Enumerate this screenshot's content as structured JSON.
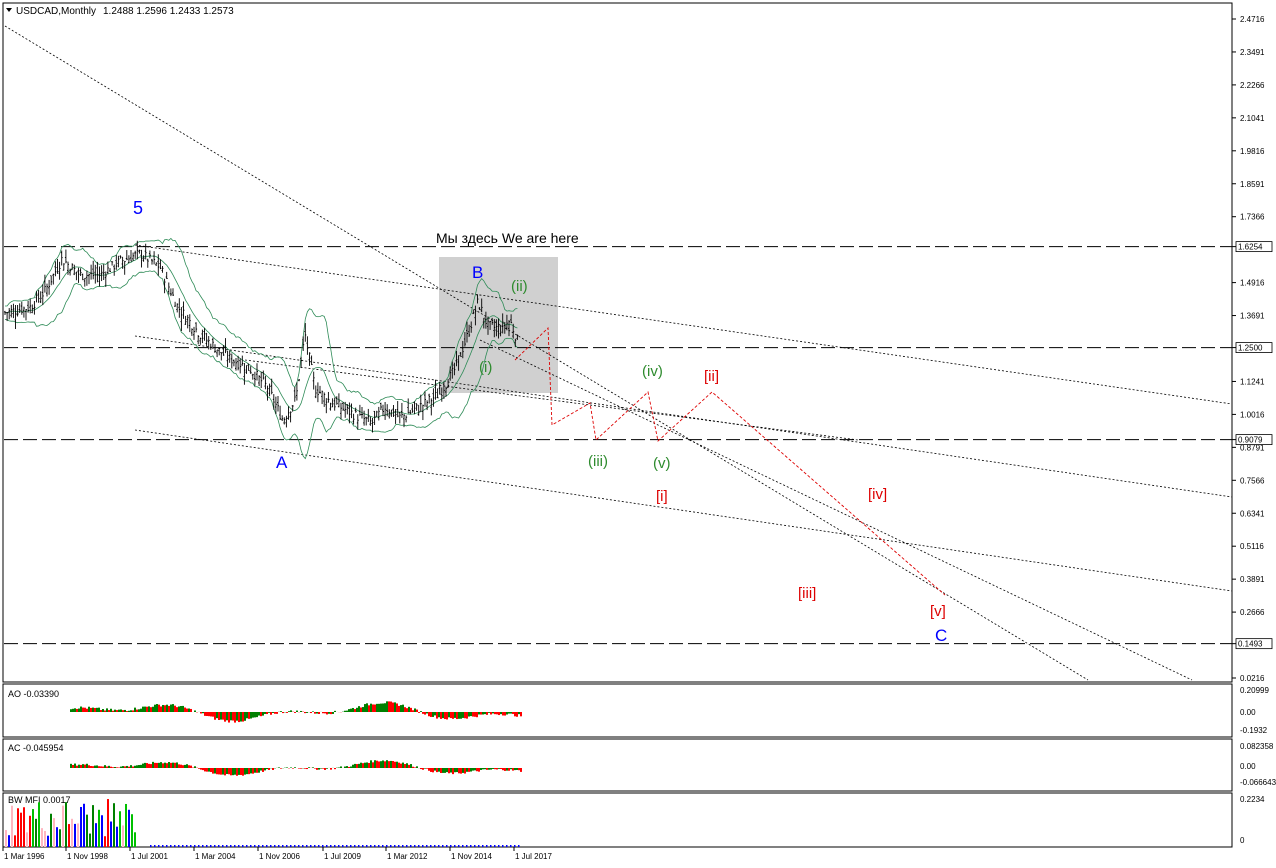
{
  "header": {
    "symbol_label": "USDCAD,Monthly",
    "ohlc": "1.2488 1.2596 1.2433 1.2573"
  },
  "annotation_here": "Мы здесь We are here",
  "price_axis": [
    "2.4716",
    "2.3491",
    "2.2266",
    "2.1041",
    "1.9816",
    "1.8591",
    "1.7366",
    "1.6254",
    "1.4916",
    "1.3691",
    "1.2500",
    "1.1241",
    "1.0016",
    "0.9079",
    "0.8791",
    "0.7566",
    "0.6341",
    "0.5116",
    "0.3891",
    "0.2666",
    "0.1493",
    "0.0216"
  ],
  "price_levels": [
    {
      "label": "1.6254",
      "value": 1.6254
    },
    {
      "label": "1.2500",
      "value": 1.25
    },
    {
      "label": "0.9079",
      "value": 0.9079
    },
    {
      "label": "0.1493",
      "value": 0.1493
    }
  ],
  "time_axis": [
    "1 Mar 1996",
    "1 Nov 1998",
    "1 Jul 2001",
    "1 Mar 2004",
    "1 Nov 2006",
    "1 Jul 2009",
    "1 Mar 2012",
    "1 Nov 2014",
    "1 Jul 2017"
  ],
  "wave_labels": [
    {
      "text": "5",
      "color": "#0000ff"
    },
    {
      "text": "A",
      "color": "#0000ff"
    },
    {
      "text": "B",
      "color": "#0000ff"
    },
    {
      "text": "C",
      "color": "#0000ff"
    },
    {
      "text": "(i)",
      "color": "#2e8b2e"
    },
    {
      "text": "(ii)",
      "color": "#2e8b2e"
    },
    {
      "text": "(iii)",
      "color": "#2e8b2e"
    },
    {
      "text": "(iv)",
      "color": "#2e8b2e"
    },
    {
      "text": "(v)",
      "color": "#2e8b2e"
    },
    {
      "text": "[i]",
      "color": "#dd0000"
    },
    {
      "text": "[ii]",
      "color": "#dd0000"
    },
    {
      "text": "[iii]",
      "color": "#dd0000"
    },
    {
      "text": "[iv]",
      "color": "#dd0000"
    },
    {
      "text": "[v]",
      "color": "#dd0000"
    }
  ],
  "ao": {
    "label": "AO -0.03390",
    "scale": [
      "0.20999",
      "0.00",
      "-0.1932"
    ]
  },
  "ac": {
    "label": "AC -0.045954",
    "scale": [
      "0.082358",
      "0.00",
      "-0.066643"
    ]
  },
  "bwmfi": {
    "label": "BW MFI 0.0017",
    "scale": [
      "0.2234",
      "0"
    ]
  },
  "colors": {
    "up": "#008000",
    "down": "#ff0000",
    "bands": "#2e8b57",
    "text": "#000000"
  },
  "chart_data": {
    "type": "line",
    "title": "USDCAD,Monthly",
    "x": [
      "1 Mar 1996",
      "1 Nov 1998",
      "1 Jul 2001",
      "1 Mar 2004",
      "1 Nov 2006",
      "1 Jul 2009",
      "1 Mar 2012",
      "1 Nov 2014",
      "1 Jul 2017"
    ],
    "series": [
      {
        "values": [
          1.37,
          1.56,
          1.59,
          1.3,
          1.05,
          1.25,
          0.99,
          1.22,
          1.38
        ]
      }
    ],
    "ylim": [
      0.0216,
      2.5
    ]
  }
}
